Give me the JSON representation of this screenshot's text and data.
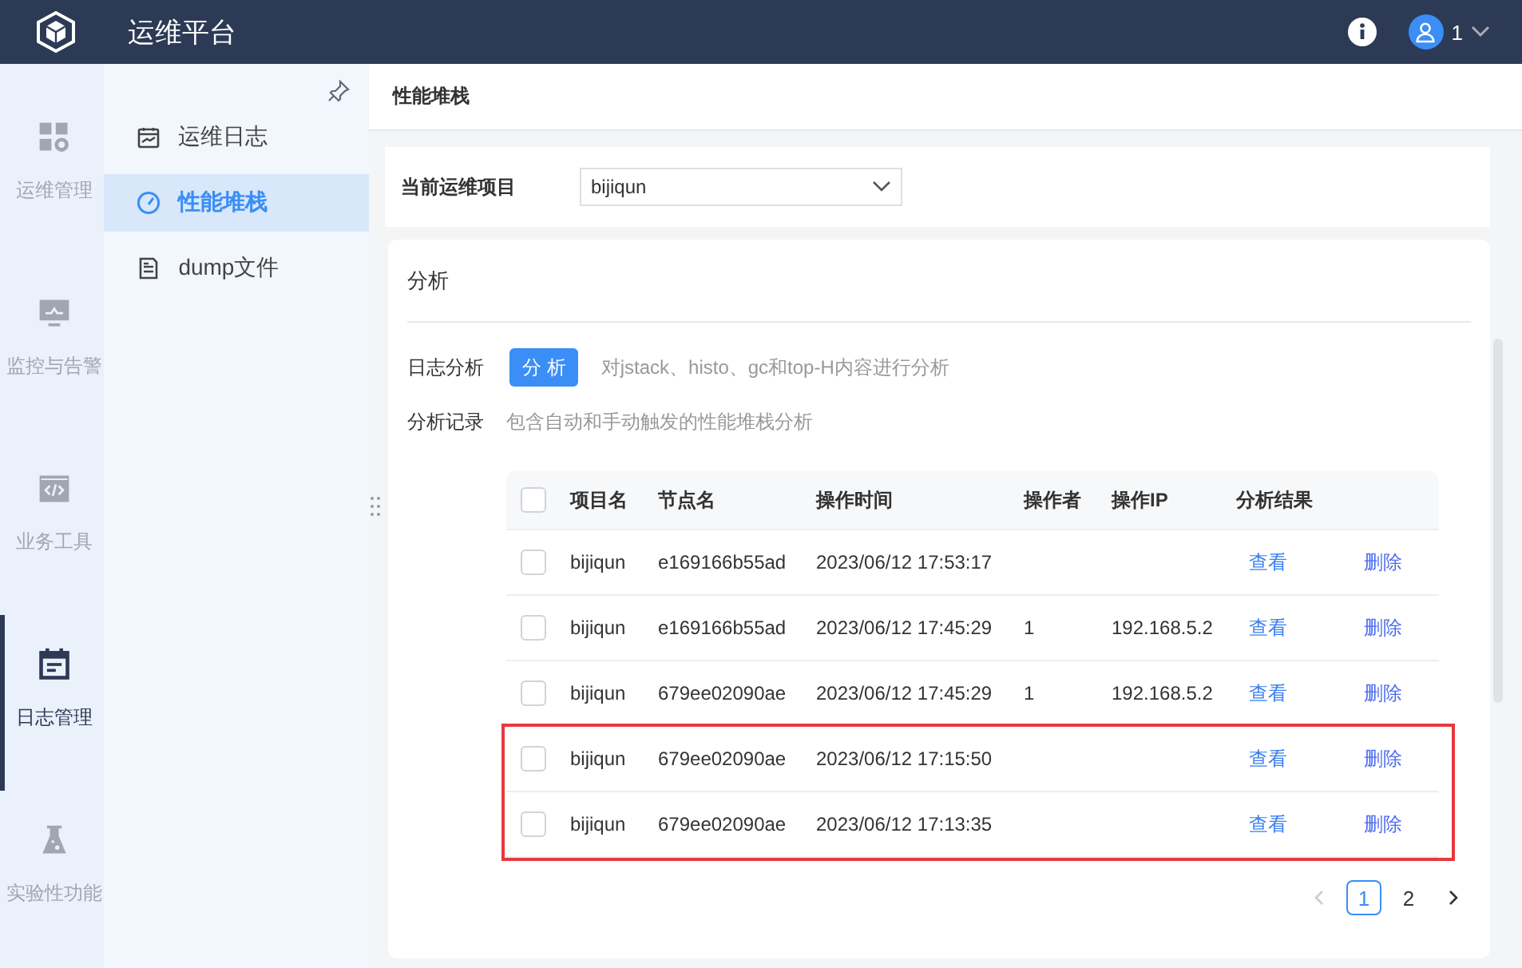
{
  "header": {
    "title": "运维平台",
    "user": "1"
  },
  "rail": [
    {
      "label": "运维管理",
      "kind": "grid",
      "selected": false
    },
    {
      "label": "监控与告警",
      "kind": "monitor",
      "selected": false
    },
    {
      "label": "业务工具",
      "kind": "code",
      "selected": false
    },
    {
      "label": "日志管理",
      "kind": "calendar",
      "selected": true
    },
    {
      "label": "实验性功能",
      "kind": "flask",
      "selected": false
    }
  ],
  "submenu": [
    {
      "label": "运维日志",
      "kind": "chart",
      "selected": false
    },
    {
      "label": "性能堆栈",
      "kind": "gauge",
      "selected": true
    },
    {
      "label": "dump文件",
      "kind": "document",
      "selected": false
    }
  ],
  "page_title": "性能堆栈",
  "project": {
    "label": "当前运维项目",
    "value": "bijiqun"
  },
  "analysis": {
    "title": "分析",
    "log_analysis": {
      "label": "日志分析",
      "button": "分 析",
      "hint": "对jstack、histo、gc和top-H内容进行分析"
    },
    "records": {
      "label": "分析记录",
      "hint": "包含自动和手动触发的性能堆栈分析"
    },
    "table": {
      "all_checked": false,
      "columns": [
        "项目名",
        "节点名",
        "操作时间",
        "操作者",
        "操作IP",
        "分析结果"
      ],
      "rows": [
        {
          "checked": false,
          "highlighted": false,
          "cells": [
            "bijiqun",
            "e169166b55ad",
            "2023/06/12 17:53:17",
            "",
            ""
          ],
          "view": "查看",
          "delete": "删除"
        },
        {
          "checked": false,
          "highlighted": false,
          "cells": [
            "bijiqun",
            "e169166b55ad",
            "2023/06/12 17:45:29",
            "1",
            "192.168.5.2"
          ],
          "view": "查看",
          "delete": "删除"
        },
        {
          "checked": false,
          "highlighted": false,
          "cells": [
            "bijiqun",
            "679ee02090ae",
            "2023/06/12 17:45:29",
            "1",
            "192.168.5.2"
          ],
          "view": "查看",
          "delete": "删除"
        },
        {
          "checked": false,
          "highlighted": true,
          "cells": [
            "bijiqun",
            "679ee02090ae",
            "2023/06/12 17:15:50",
            "",
            ""
          ],
          "view": "查看",
          "delete": "删除"
        },
        {
          "checked": false,
          "highlighted": true,
          "cells": [
            "bijiqun",
            "679ee02090ae",
            "2023/06/12 17:13:35",
            "",
            ""
          ],
          "view": "查看",
          "delete": "删除"
        }
      ]
    },
    "pagination": [
      {
        "label": "1",
        "selected": true
      },
      {
        "label": "2",
        "selected": false
      }
    ]
  }
}
